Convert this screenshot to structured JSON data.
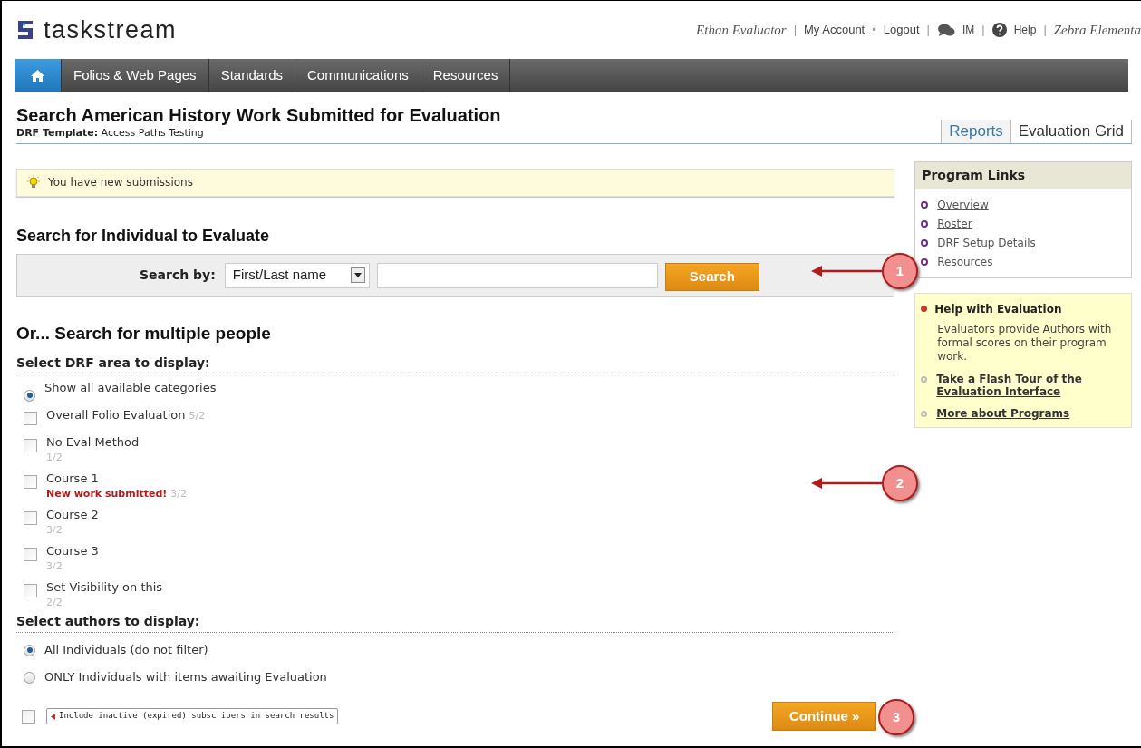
{
  "header": {
    "logo": "taskstream",
    "user": "Ethan Evaluator",
    "links": [
      {
        "kind": "text",
        "separator": "|",
        "label": "My Account"
      },
      {
        "kind": "text",
        "separator": "•",
        "label": "Logout"
      },
      {
        "kind": "chat",
        "separator": "|",
        "label": "IM"
      },
      {
        "kind": "help",
        "separator": "|",
        "label": "Help"
      }
    ],
    "organization_separator": "|",
    "organization": "Zebra Elementa"
  },
  "nav": [
    {
      "kind": "home",
      "selected": true
    },
    {
      "kind": "text",
      "label": "Folios & Web Pages",
      "selected": false
    },
    {
      "kind": "text",
      "label": "Standards",
      "selected": false
    },
    {
      "kind": "text",
      "label": "Communications",
      "selected": false
    },
    {
      "kind": "text",
      "label": "Resources",
      "selected": false
    }
  ],
  "page": {
    "title": "Search American History Work Submitted for Evaluation",
    "subtitle": "**DRF Template:** Access Paths Testing"
  },
  "view_tabs": [
    {
      "label": "Reports",
      "selected": false
    },
    {
      "label": "Evaluation Grid",
      "selected": true
    }
  ],
  "notice": "You have new submissions",
  "individual_search": {
    "heading": "Search for Individual to Evaluate",
    "label": "Search by:",
    "select": "First/Last name",
    "button": "Search"
  },
  "multiple_search": {
    "heading": "Or... Search for multiple people",
    "drf_heading": "Select DRF area to display:",
    "drf_items": [
      {
        "kind": "radio",
        "label": "Show all available categories",
        "selected": true
      },
      {
        "kind": "checkbox",
        "label": "Overall Folio Evaluation",
        "count": "5/2",
        "checked": false
      },
      {
        "kind": "checkbox",
        "label": "No Eval Method",
        "count": "1/2",
        "checked": false
      },
      {
        "kind": "checkbox",
        "label": "Course 1",
        "note": "New work submitted!",
        "count": "3/2",
        "checked": false
      },
      {
        "kind": "checkbox",
        "label": "Course 2",
        "count": "3/2",
        "checked": false
      },
      {
        "kind": "checkbox",
        "label": "Course 3",
        "count": "3/2",
        "checked": false
      },
      {
        "kind": "checkbox",
        "label": "Set Visibility on this",
        "count": "2/2",
        "checked": false
      }
    ],
    "authors_heading": "Select authors to display:",
    "author_options": [
      {
        "label": "All Individuals (do not filter)",
        "selected": true
      },
      {
        "label": "ONLY Individuals with items awaiting Evaluation",
        "selected": false
      }
    ],
    "inactive": {
      "label": "Include inactive (expired) subscribers in search results",
      "checked": false
    },
    "button": "Continue »"
  },
  "sidebar": {
    "links_title": "Program Links",
    "links": [
      "Overview",
      "Roster",
      "DRF Setup Details",
      "Resources"
    ],
    "help_title": "Help with Evaluation",
    "help_text": "Evaluators provide Authors with formal scores on their program work.",
    "help_links": [
      "Take a Flash Tour of the Evaluation Interface",
      "More about Programs"
    ]
  },
  "callouts": [
    "1",
    "2",
    "3"
  ]
}
